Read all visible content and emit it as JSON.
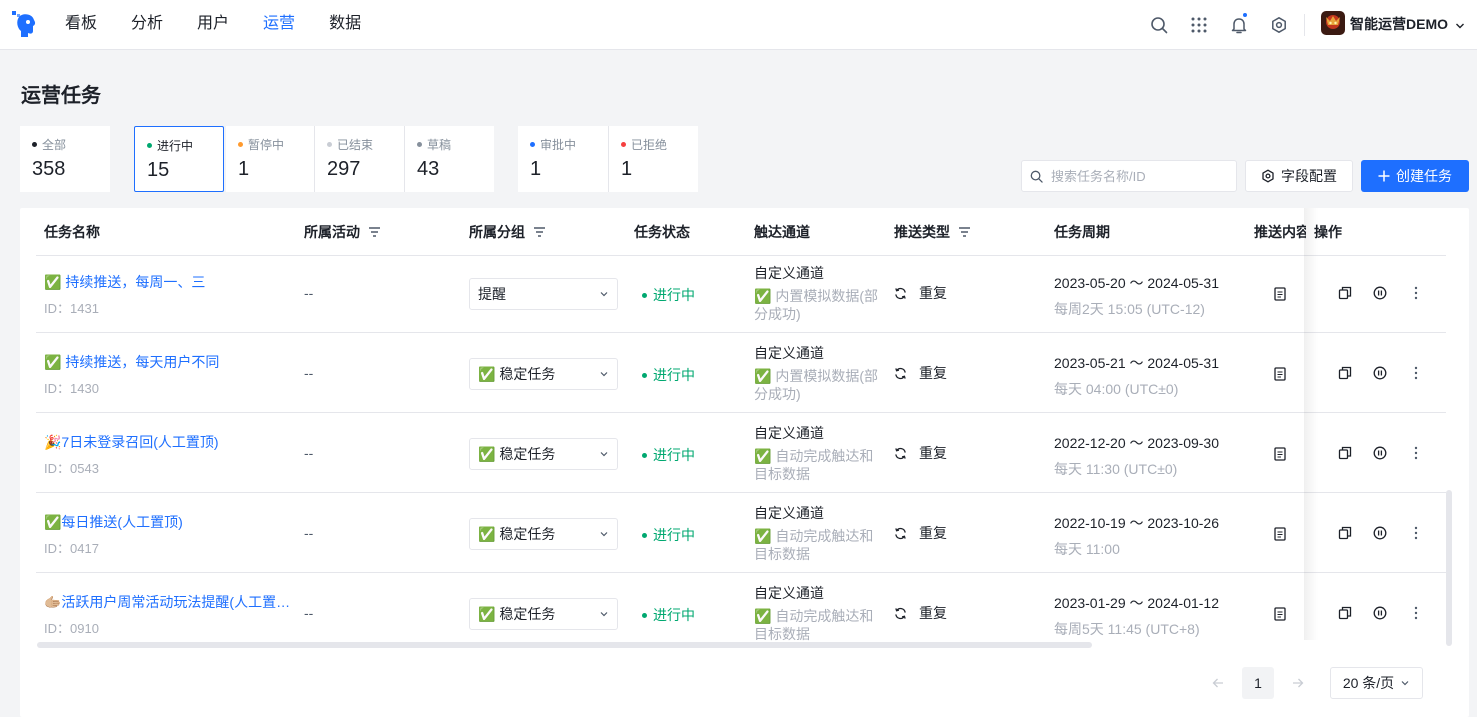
{
  "nav": {
    "items": [
      "看板",
      "分析",
      "用户",
      "运营",
      "数据"
    ],
    "active_index": 3
  },
  "header": {
    "user_name": "智能运营DEMO",
    "icons": [
      "search-icon",
      "apps-grid-icon",
      "bell-icon",
      "gear-icon"
    ]
  },
  "page": {
    "title": "运营任务"
  },
  "stats": [
    {
      "label": "全部",
      "value": "358",
      "dot_color": "#1d2129"
    },
    {
      "label": "进行中",
      "value": "15",
      "dot_color": "#00a870"
    },
    {
      "label": "暂停中",
      "value": "1",
      "dot_color": "#ff9a2e"
    },
    {
      "label": "已结束",
      "value": "297",
      "dot_color": "#c9cdd4"
    },
    {
      "label": "草稿",
      "value": "43",
      "dot_color": "#86909c"
    },
    {
      "label": "审批中",
      "value": "1",
      "dot_color": "#1e6fff"
    },
    {
      "label": "已拒绝",
      "value": "1",
      "dot_color": "#f53f3f"
    }
  ],
  "toolbar": {
    "search_placeholder": "搜索任务名称/ID",
    "field_config_label": "字段配置",
    "create_label": "创建任务"
  },
  "table": {
    "columns": [
      "任务名称",
      "所属活动",
      "所属分组",
      "任务状态",
      "触达通道",
      "推送类型",
      "任务周期",
      "推送内容",
      "操作"
    ],
    "rows": [
      {
        "name": "✅ 持续推送，每周一、三",
        "id": "ID：1431",
        "activity": "--",
        "group": "提醒",
        "status": "进行中",
        "channel": "自定义通道",
        "channel_sub": "✅ 内置模拟数据(部分成功)",
        "push_type": "重复",
        "period": "2023-05-20 ～ 2024-05-31",
        "period_sub": "每周2天 15:05  (UTC-12)"
      },
      {
        "name": "✅ 持续推送，每天用户不同",
        "id": "ID：1430",
        "activity": "--",
        "group": "✅ 稳定任务",
        "status": "进行中",
        "channel": "自定义通道",
        "channel_sub": "✅ 内置模拟数据(部分成功)",
        "push_type": "重复",
        "period": "2023-05-21 ～ 2024-05-31",
        "period_sub": "每天 04:00  (UTC±0)"
      },
      {
        "name": "🎉7日未登录召回(人工置顶)",
        "id": "ID：0543",
        "activity": "--",
        "group": "✅ 稳定任务",
        "status": "进行中",
        "channel": "自定义通道",
        "channel_sub": "✅ 自动完成触达和目标数据",
        "push_type": "重复",
        "period": "2022-12-20 ～ 2023-09-30",
        "period_sub": "每天 11:30  (UTC±0)"
      },
      {
        "name": "✅每日推送(人工置顶)",
        "id": "ID：0417",
        "activity": "--",
        "group": "✅ 稳定任务",
        "status": "进行中",
        "channel": "自定义通道",
        "channel_sub": "✅ 自动完成触达和目标数据",
        "push_type": "重复",
        "period": "2022-10-19 ～ 2023-10-26",
        "period_sub": "每天 11:00"
      },
      {
        "name": "🫱🏼活跃用户周常活动玩法提醒(人工置顶)",
        "id": "ID：0910",
        "activity": "--",
        "group": "✅ 稳定任务",
        "status": "进行中",
        "channel": "自定义通道",
        "channel_sub": "✅ 自动完成触达和目标数据",
        "push_type": "重复",
        "period": "2023-01-29 ～ 2024-01-12",
        "period_sub": "每周5天 11:45  (UTC+8)"
      }
    ]
  },
  "pager": {
    "current": "1",
    "page_size": "20 条/页"
  }
}
